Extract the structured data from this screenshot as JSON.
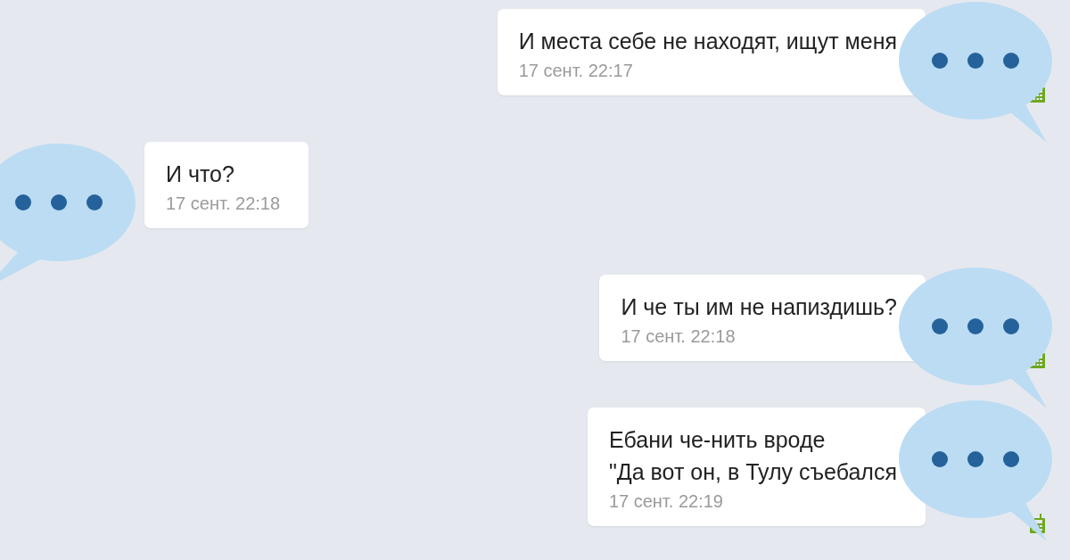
{
  "messages": [
    {
      "kind": "out",
      "lines": [
        "И места себе не находят, ищут меня"
      ],
      "time": "17 сент. 22:17"
    },
    {
      "kind": "in",
      "lines": [
        "И что?"
      ],
      "time": "17 сент. 22:18"
    },
    {
      "kind": "out",
      "lines": [
        "И че ты им не напиздишь?"
      ],
      "time": "17 сент. 22:18"
    },
    {
      "kind": "out",
      "lines": [
        "Ебани че-нить вроде",
        "\"Да вот он, в Тулу съебался"
      ],
      "time": "17 сент. 22:19"
    }
  ]
}
